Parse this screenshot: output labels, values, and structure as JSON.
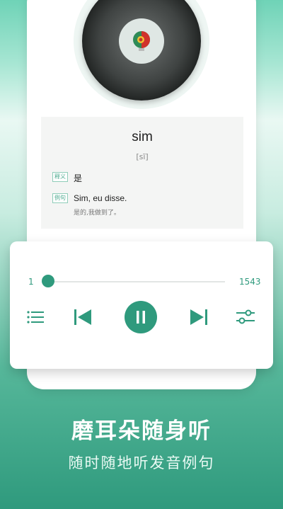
{
  "word_card": {
    "word": "sim",
    "phonetic": "[sĩ]",
    "meaning_tag": "释义",
    "meaning": "是",
    "example_tag": "例句",
    "example": "Sim, eu disse.",
    "example_translation": "是的,我做到了。"
  },
  "player": {
    "current": "1",
    "total": "1543",
    "progress": 0.0,
    "icons": [
      "list-icon",
      "previous-icon",
      "pause-icon",
      "next-icon",
      "settings-sliders-icon"
    ],
    "accent_color": "#2f9a7d"
  },
  "promo": {
    "title": "磨耳朵随身听",
    "subtitle": "随时随地听发音例句"
  }
}
